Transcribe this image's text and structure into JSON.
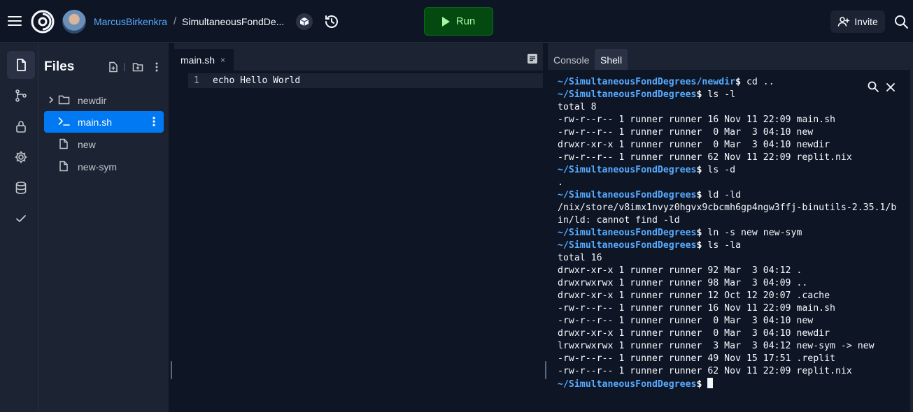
{
  "topbar": {
    "username": "MarcusBirkenkra",
    "separator": "/",
    "repl_name": "SimultaneousFondDe...",
    "run_label": "Run",
    "invite_label": "Invite"
  },
  "files_panel": {
    "title": "Files",
    "items": [
      {
        "name": "newdir",
        "type": "folder"
      },
      {
        "name": "main.sh",
        "type": "shell-file",
        "active": true
      },
      {
        "name": "new",
        "type": "file"
      },
      {
        "name": "new-sym",
        "type": "file"
      }
    ]
  },
  "editor": {
    "tab_label": "main.sh",
    "tab_close": "×",
    "lines": [
      {
        "number": "1",
        "code": "echo Hello World"
      }
    ]
  },
  "shell_panel": {
    "tabs": [
      "Console",
      "Shell"
    ],
    "active_tab": "Shell",
    "prompt_path": "~/SimultaneousFondDegrees",
    "terminal": [
      {
        "kind": "prompt",
        "path": "~/SimultaneousFondDegrees/newdir",
        "cmd": " cd .."
      },
      {
        "kind": "prompt",
        "path": "~/SimultaneousFondDegrees",
        "cmd": " ls -l"
      },
      {
        "kind": "out",
        "text": "total 8"
      },
      {
        "kind": "out",
        "text": "-rw-r--r-- 1 runner runner 16 Nov 11 22:09 main.sh"
      },
      {
        "kind": "out",
        "text": "-rw-r--r-- 1 runner runner  0 Mar  3 04:10 new"
      },
      {
        "kind": "out",
        "text": "drwxr-xr-x 1 runner runner  0 Mar  3 04:10 newdir"
      },
      {
        "kind": "out",
        "text": "-rw-r--r-- 1 runner runner 62 Nov 11 22:09 replit.nix"
      },
      {
        "kind": "prompt",
        "path": "~/SimultaneousFondDegrees",
        "cmd": " ls -d"
      },
      {
        "kind": "out",
        "text": "."
      },
      {
        "kind": "prompt",
        "path": "~/SimultaneousFondDegrees",
        "cmd": " ld -ld"
      },
      {
        "kind": "out",
        "text": "/nix/store/v8imx1nvyz0hgvx9cbcmh6gp4ngw3ffj-binutils-2.35.1/b"
      },
      {
        "kind": "out",
        "text": "in/ld: cannot find -ld"
      },
      {
        "kind": "prompt",
        "path": "~/SimultaneousFondDegrees",
        "cmd": " ln -s new new-sym"
      },
      {
        "kind": "prompt",
        "path": "~/SimultaneousFondDegrees",
        "cmd": " ls -la"
      },
      {
        "kind": "out",
        "text": "total 16"
      },
      {
        "kind": "out",
        "text": "drwxr-xr-x 1 runner runner 92 Mar  3 04:12 ."
      },
      {
        "kind": "out",
        "text": "drwxrwxrwx 1 runner runner 98 Mar  3 04:09 .."
      },
      {
        "kind": "out",
        "text": "drwxr-xr-x 1 runner runner 12 Oct 12 20:07 .cache"
      },
      {
        "kind": "out",
        "text": "-rw-r--r-- 1 runner runner 16 Nov 11 22:09 main.sh"
      },
      {
        "kind": "out",
        "text": "-rw-r--r-- 1 runner runner  0 Mar  3 04:10 new"
      },
      {
        "kind": "out",
        "text": "drwxr-xr-x 1 runner runner  0 Mar  3 04:10 newdir"
      },
      {
        "kind": "out",
        "text": "lrwxrwxrwx 1 runner runner  3 Mar  3 04:12 new-sym -> new"
      },
      {
        "kind": "out",
        "text": "-rw-r--r-- 1 runner runner 49 Nov 15 17:51 .replit"
      },
      {
        "kind": "out",
        "text": "-rw-r--r-- 1 runner runner 62 Nov 11 22:09 replit.nix"
      },
      {
        "kind": "current",
        "path": "~/SimultaneousFondDegrees",
        "cmd": " "
      }
    ]
  },
  "icons": {
    "menu": "hamburger-icon",
    "logo": "replit-logo-icon",
    "history": "history-icon",
    "run": "play-icon",
    "invite": "add-user-icon",
    "search": "search-icon",
    "rail": [
      "files-icon",
      "git-icon",
      "lock-icon",
      "gear-icon",
      "database-icon",
      "check-icon"
    ]
  },
  "colors": {
    "background": "#0e1525",
    "panel": "#1c2333",
    "accent": "#0079f2",
    "link": "#57abff",
    "run_bg": "#044a10",
    "run_text": "#a4f5a4"
  }
}
